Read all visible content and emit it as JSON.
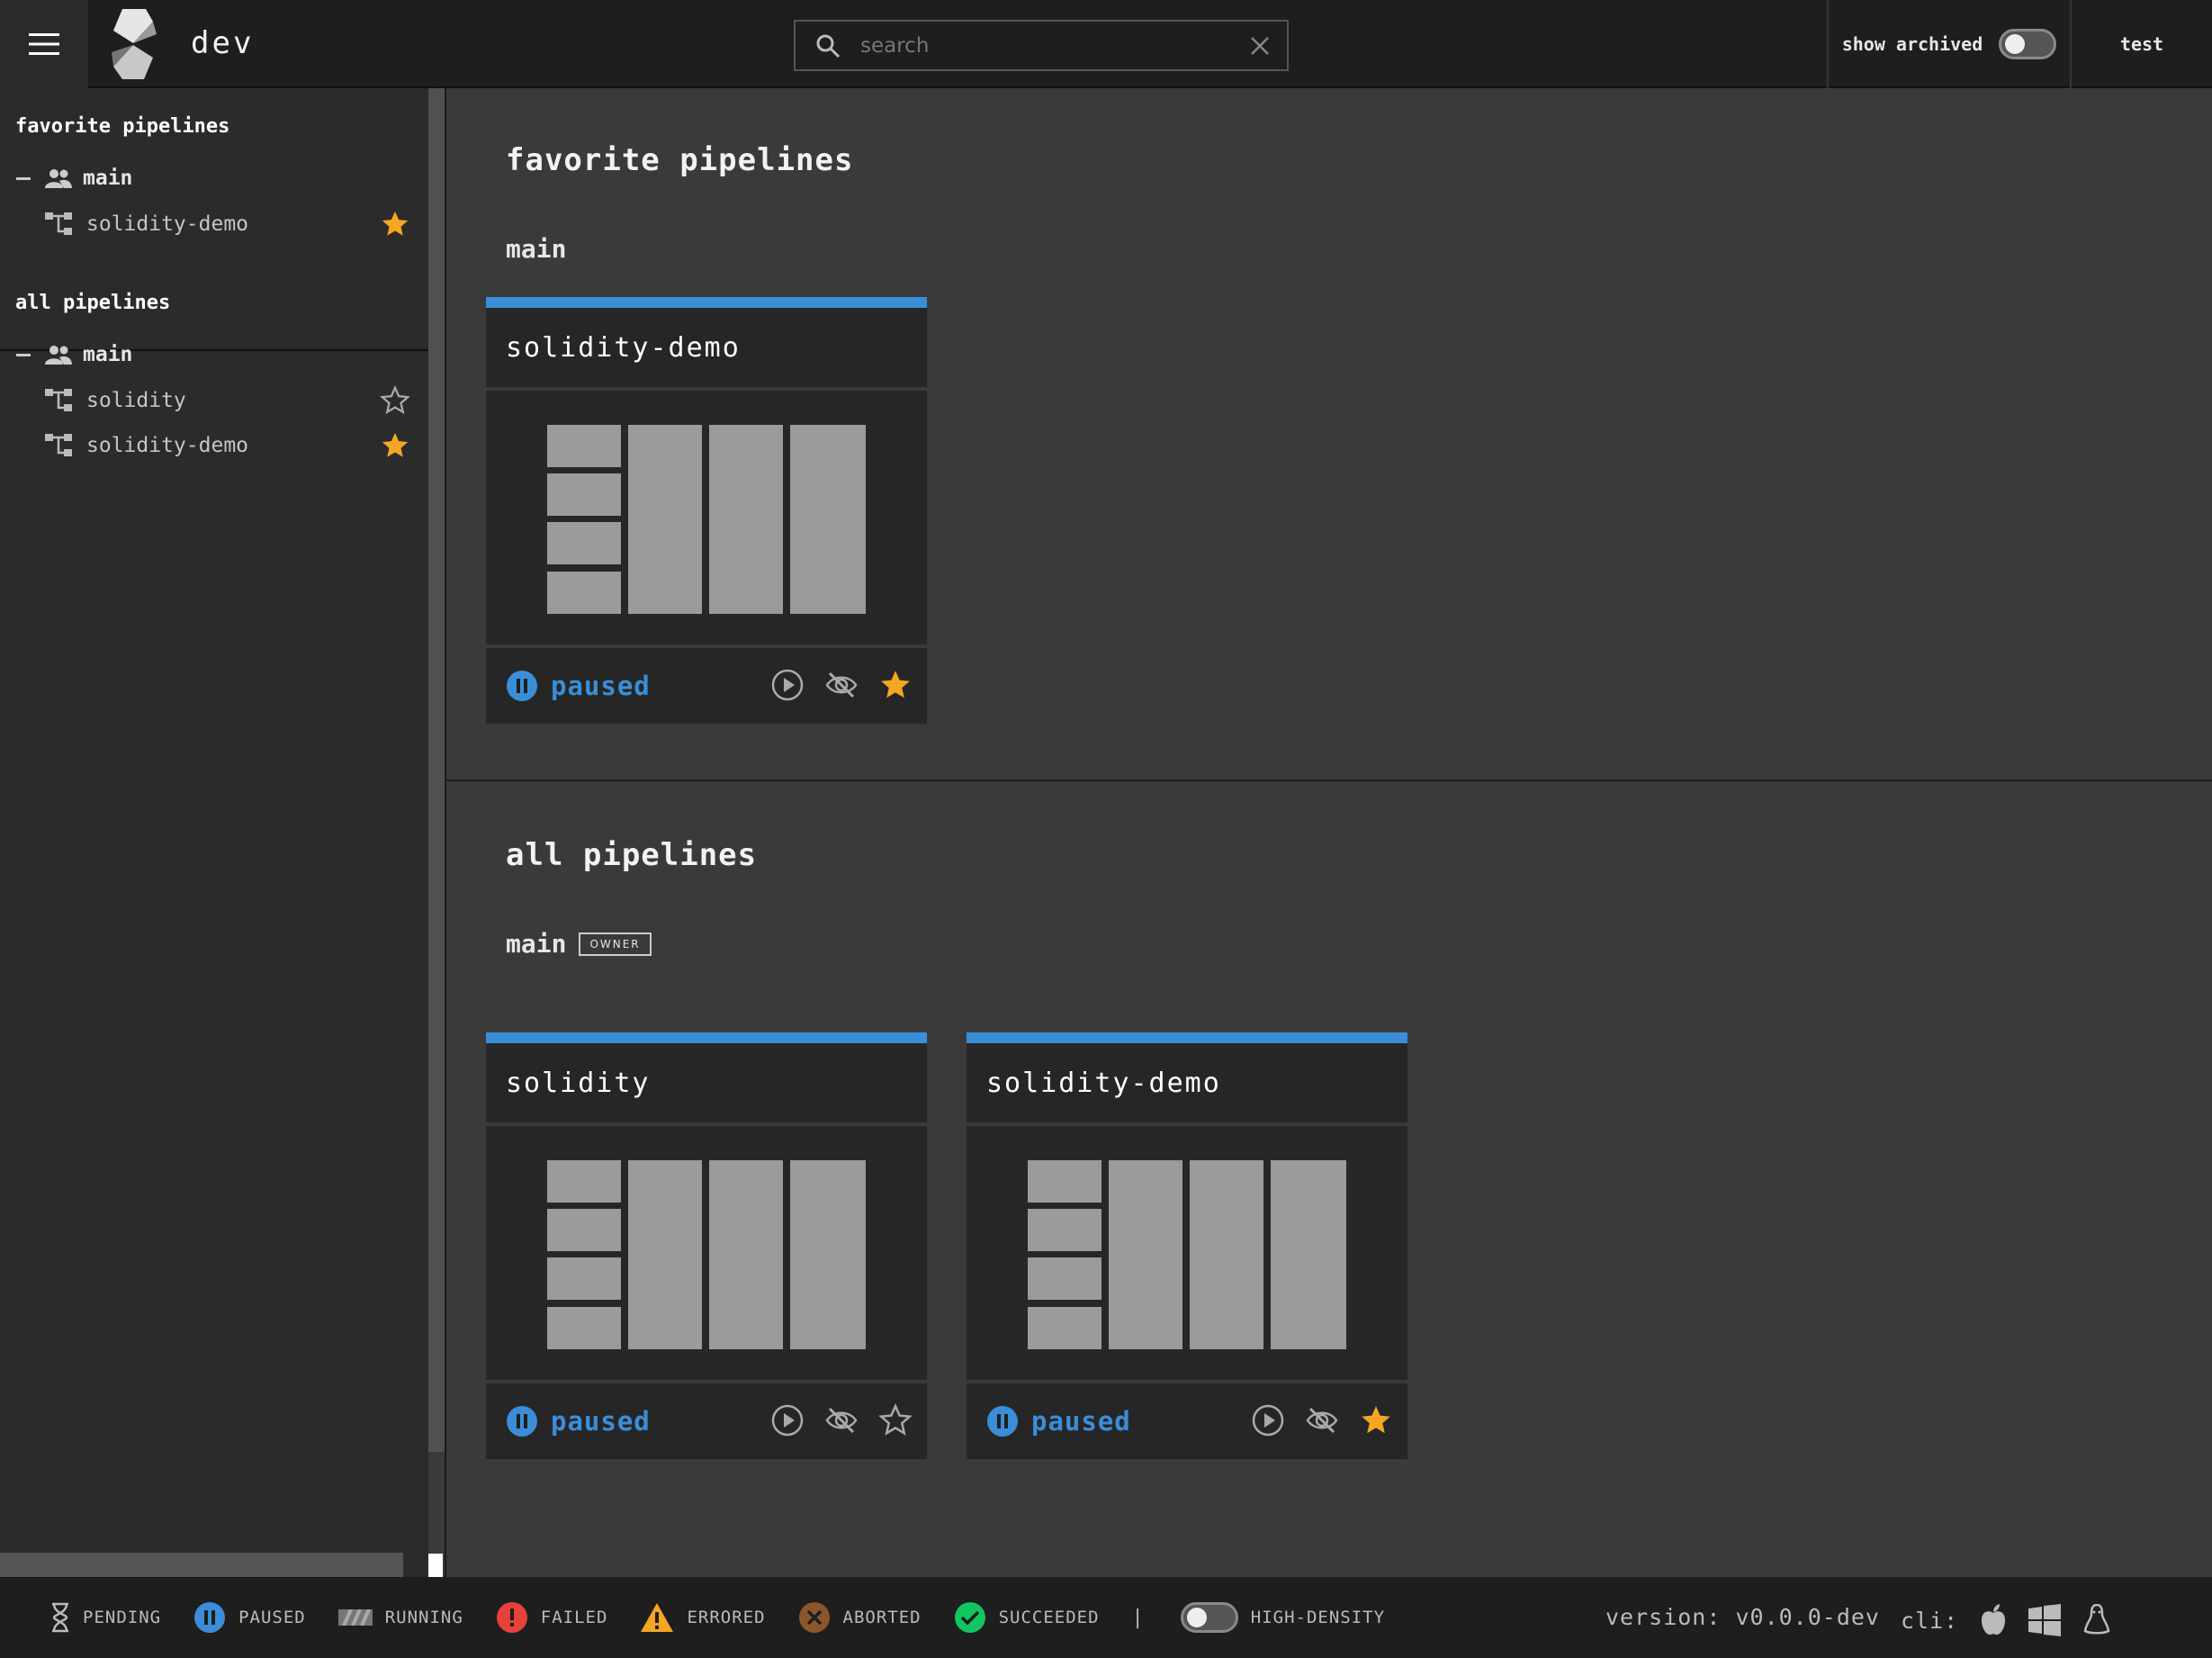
{
  "topbar": {
    "team": "dev",
    "search_placeholder": "search",
    "show_archived_label": "show archived",
    "user": "test"
  },
  "sidebar": {
    "favorites_title": "favorite pipelines",
    "favorites_team": "main",
    "favorites": [
      {
        "name": "solidity-demo",
        "favorite": true
      }
    ],
    "all_title": "all pipelines",
    "all_team": "main",
    "all": [
      {
        "name": "solidity",
        "favorite": false
      },
      {
        "name": "solidity-demo",
        "favorite": true
      }
    ]
  },
  "main": {
    "favorites_title": "favorite pipelines",
    "favorites_team": "main",
    "favorite_cards": [
      {
        "name": "solidity-demo",
        "status": "paused",
        "favorite": true
      }
    ],
    "all_title": "all pipelines",
    "all_team": "main",
    "owner_badge": "OWNER",
    "all_cards": [
      {
        "name": "solidity",
        "status": "paused",
        "favorite": false
      },
      {
        "name": "solidity-demo",
        "status": "paused",
        "favorite": true
      }
    ]
  },
  "footer": {
    "legend": [
      "PENDING",
      "PAUSED",
      "RUNNING",
      "FAILED",
      "ERRORED",
      "ABORTED",
      "SUCCEEDED"
    ],
    "separator": "|",
    "high_density": "HIGH-DENSITY",
    "version": "version: v0.0.0-dev",
    "cli": "cli:"
  },
  "colors": {
    "accent_blue": "#3a8ed8",
    "star_gold": "#f5a623",
    "failed": "#e8403a",
    "errored": "#f5a623",
    "aborted": "#8b572a",
    "succeeded": "#11c560"
  }
}
